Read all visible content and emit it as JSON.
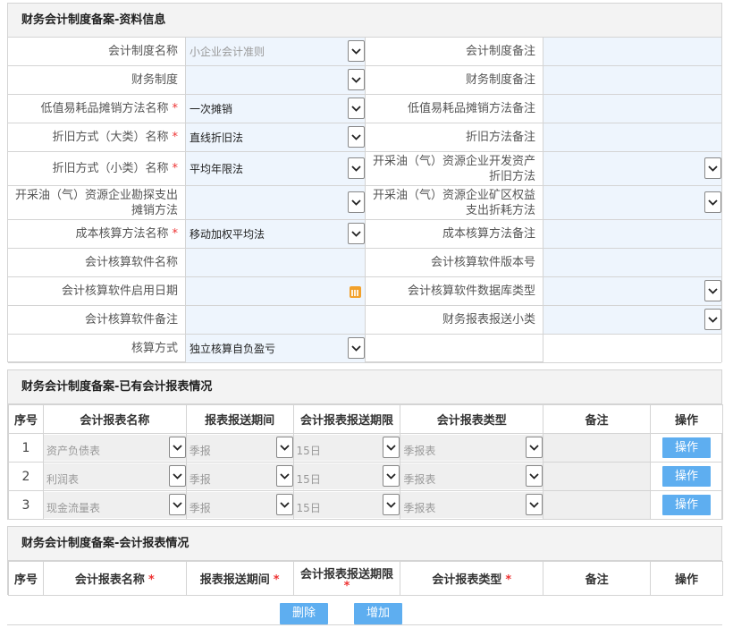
{
  "section1": {
    "title": "财务会计制度备案-资料信息",
    "rows": [
      {
        "l1": "会计制度名称",
        "r1": false,
        "v1": "小企业会计准则",
        "v1dis": true,
        "dd1": true,
        "l2": "会计制度备注",
        "r2": false,
        "v2": "",
        "dd2": false
      },
      {
        "l1": "财务制度",
        "r1": false,
        "v1": "",
        "dd1": true,
        "l2": "财务制度备注",
        "v2": "",
        "dd2": false
      },
      {
        "l1": "低值易耗品摊销方法名称",
        "r1": true,
        "v1": "一次摊销",
        "dd1": true,
        "l2": "低值易耗品摊销方法备注",
        "v2": "",
        "dd2": false
      },
      {
        "l1": "折旧方式（大类）名称",
        "r1": true,
        "v1": "直线折旧法",
        "dd1": true,
        "l2": "折旧方法备注",
        "v2": "",
        "dd2": false
      },
      {
        "l1": "折旧方式（小类）名称",
        "r1": true,
        "v1": "平均年限法",
        "dd1": true,
        "l2": "开采油（气）资源企业开发资产折旧方法",
        "v2": "",
        "dd2": true
      },
      {
        "l1": "开采油（气）资源企业勘探支出摊销方法",
        "r1": false,
        "v1": "",
        "dd1": true,
        "l2": "开采油（气）资源企业矿区权益支出折耗方法",
        "v2": "",
        "dd2": true
      },
      {
        "l1": "成本核算方法名称",
        "r1": true,
        "v1": "移动加权平均法",
        "dd1": true,
        "l2": "成本核算方法备注",
        "v2": "",
        "dd2": false
      },
      {
        "l1": "会计核算软件名称",
        "r1": false,
        "v1": "",
        "dd1": false,
        "l2": "会计核算软件版本号",
        "v2": "",
        "dd2": false
      },
      {
        "l1": "会计核算软件启用日期",
        "r1": false,
        "v1": "",
        "dd1": false,
        "cal1": true,
        "l2": "会计核算软件数据库类型",
        "v2": "",
        "dd2": true
      },
      {
        "l1": "会计核算软件备注",
        "r1": false,
        "v1": "",
        "dd1": false,
        "l2": "财务报表报送小类",
        "v2": "",
        "dd2": true
      },
      {
        "l1": "核算方式",
        "r1": false,
        "v1": "独立核算自负盈亏",
        "dd1": true,
        "l2": "",
        "v2": "",
        "dd2": false
      }
    ]
  },
  "section2": {
    "title": "财务会计制度备案-已有会计报表情况",
    "headers": [
      "序号",
      "会计报表名称",
      "报表报送期间",
      "会计报表报送期限",
      "会计报表类型",
      "备注",
      "操作"
    ],
    "rows": [
      {
        "no": "1",
        "name": "资产负债表",
        "period": "季报",
        "limit": "15日",
        "type": "季报表",
        "note": "",
        "op": "操作"
      },
      {
        "no": "2",
        "name": "利润表",
        "period": "季报",
        "limit": "15日",
        "type": "季报表",
        "note": "",
        "op": "操作"
      },
      {
        "no": "3",
        "name": "现金流量表",
        "period": "季报",
        "limit": "15日",
        "type": "季报表",
        "note": "",
        "op": "操作"
      }
    ]
  },
  "section3": {
    "title": "财务会计制度备案-会计报表情况",
    "headers": [
      {
        "t": "序号",
        "r": false
      },
      {
        "t": "会计报表名称",
        "r": true
      },
      {
        "t": "报表报送期间",
        "r": true
      },
      {
        "t": "会计报表报送期限",
        "r": true
      },
      {
        "t": "会计报表类型",
        "r": true
      },
      {
        "t": "备注",
        "r": false
      },
      {
        "t": "操作",
        "r": false
      }
    ],
    "req_mark": "*"
  },
  "buttons": {
    "delete": "删除",
    "add": "增加"
  },
  "colors": {
    "accent": "#5eaef0",
    "field_bg": "#eef5fd",
    "required": "#e33333"
  }
}
